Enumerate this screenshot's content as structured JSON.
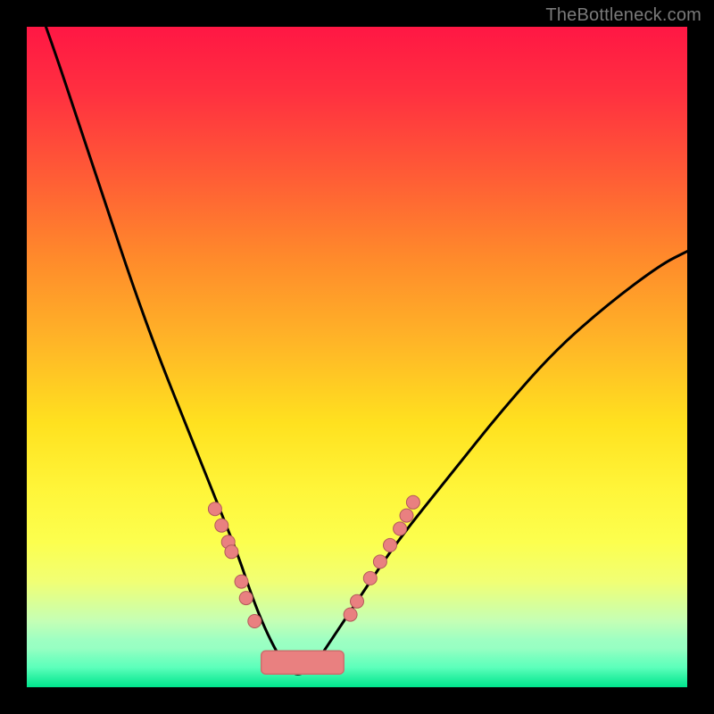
{
  "watermark": {
    "text": "TheBottleneck.com"
  },
  "colors": {
    "curve": "#000000",
    "dot_fill": "#e98080",
    "dot_stroke": "#b25a5a",
    "bar_fill": "#e98080",
    "bar_stroke": "#cf6d6d"
  },
  "chart_data": {
    "type": "line",
    "title": "",
    "xlabel": "",
    "ylabel": "",
    "xlim": [
      0,
      100
    ],
    "ylim": [
      0,
      100
    ],
    "grid": false,
    "legend": false,
    "note": "V-shaped bottleneck curve over a vertical heat gradient (red at top = high bottleneck, green at bottom = optimal). Minimum of curve ≈ x 40.",
    "series": [
      {
        "name": "bottleneck-curve",
        "x": [
          0,
          4,
          8,
          12,
          16,
          20,
          24,
          28,
          32,
          34,
          36,
          38,
          40,
          42,
          44,
          46,
          50,
          56,
          64,
          72,
          80,
          88,
          96,
          100
        ],
        "values": [
          108,
          97,
          85,
          73,
          61,
          50,
          40,
          30,
          20,
          14,
          9,
          5,
          2,
          2,
          4,
          7,
          13,
          22,
          32,
          42,
          51,
          58,
          64,
          66
        ]
      }
    ],
    "markers_left": {
      "name": "left-branch-dots",
      "x": [
        28.5,
        29.5,
        30.5,
        31.0,
        32.5,
        33.2,
        34.5
      ],
      "values": [
        27.0,
        24.5,
        22.0,
        20.5,
        16.0,
        13.5,
        10.0
      ]
    },
    "markers_right": {
      "name": "right-branch-dots",
      "x": [
        49.0,
        50.0,
        52.0,
        53.5,
        55.0,
        56.5,
        57.5,
        58.5
      ],
      "values": [
        11.0,
        13.0,
        16.5,
        19.0,
        21.5,
        24.0,
        26.0,
        28.0
      ]
    },
    "bottom_bar": {
      "name": "optimal-range",
      "x_start": 35.5,
      "x_end": 48.0,
      "y": 2.0,
      "height": 3.5
    }
  }
}
